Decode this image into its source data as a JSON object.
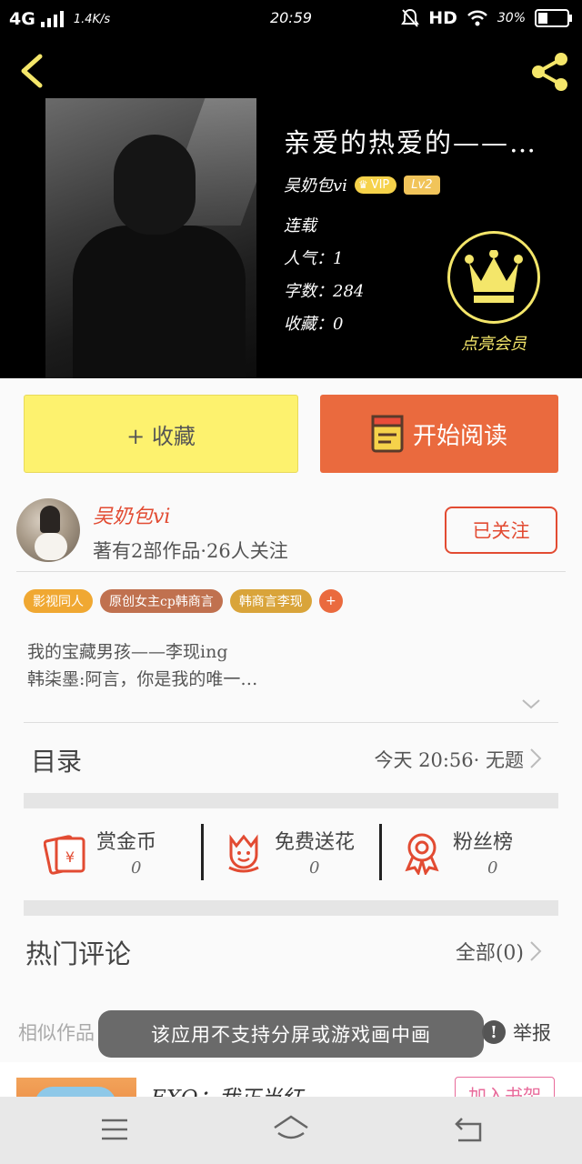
{
  "status_bar": {
    "network": "4G",
    "speed": "1.4K/s",
    "time": "20:59",
    "hd": "HD",
    "battery": "30%"
  },
  "book": {
    "title": "亲爱的热爱的——…",
    "author": "吴奶包vi",
    "vip_badge": "VIP",
    "level_badge": "Lv2",
    "status": "连载",
    "popularity": "人气：1",
    "word_count": "字数：284",
    "favorites": "收藏：0",
    "vip_member_label": "点亮会员"
  },
  "actions": {
    "collect": "+ 收藏",
    "read": "开始阅读"
  },
  "author_panel": {
    "name": "吴奶包vi",
    "stats": "著有2部作品·26人关注",
    "follow_label": "已关注"
  },
  "tags": [
    {
      "label": "影视同人",
      "color": "#f0a832"
    },
    {
      "label": "原创女主cp韩商言",
      "color": "#c0714f"
    },
    {
      "label": "韩商言李现",
      "color": "#d9a43a"
    }
  ],
  "tag_add": "+",
  "intro": {
    "line1": "我的宝藏男孩——李现ing",
    "line2": "韩柒墨:阿言，你是我的唯一…"
  },
  "toc": {
    "label": "目录",
    "latest": "今天 20:56· 无题"
  },
  "rewards": [
    {
      "label": "赏金币",
      "count": "0",
      "icon": "red-envelope-icon"
    },
    {
      "label": "免费送花",
      "count": "0",
      "icon": "flower-icon"
    },
    {
      "label": "粉丝榜",
      "count": "0",
      "icon": "medal-icon"
    }
  ],
  "comments": {
    "label": "热门评论",
    "all": "全部(0)"
  },
  "similar_label": "相似作品",
  "report": {
    "icon": "!",
    "label": "举报"
  },
  "recommend": {
    "title": "EXO：我正当红",
    "add_label": "加入书架"
  },
  "toast": "该应用不支持分屏或游戏画中画",
  "colors": {
    "accent_orange": "#ea6a3e",
    "accent_red": "#e24b32",
    "collect_yellow": "#fdf26e",
    "crown_yellow": "#f4e66a"
  }
}
